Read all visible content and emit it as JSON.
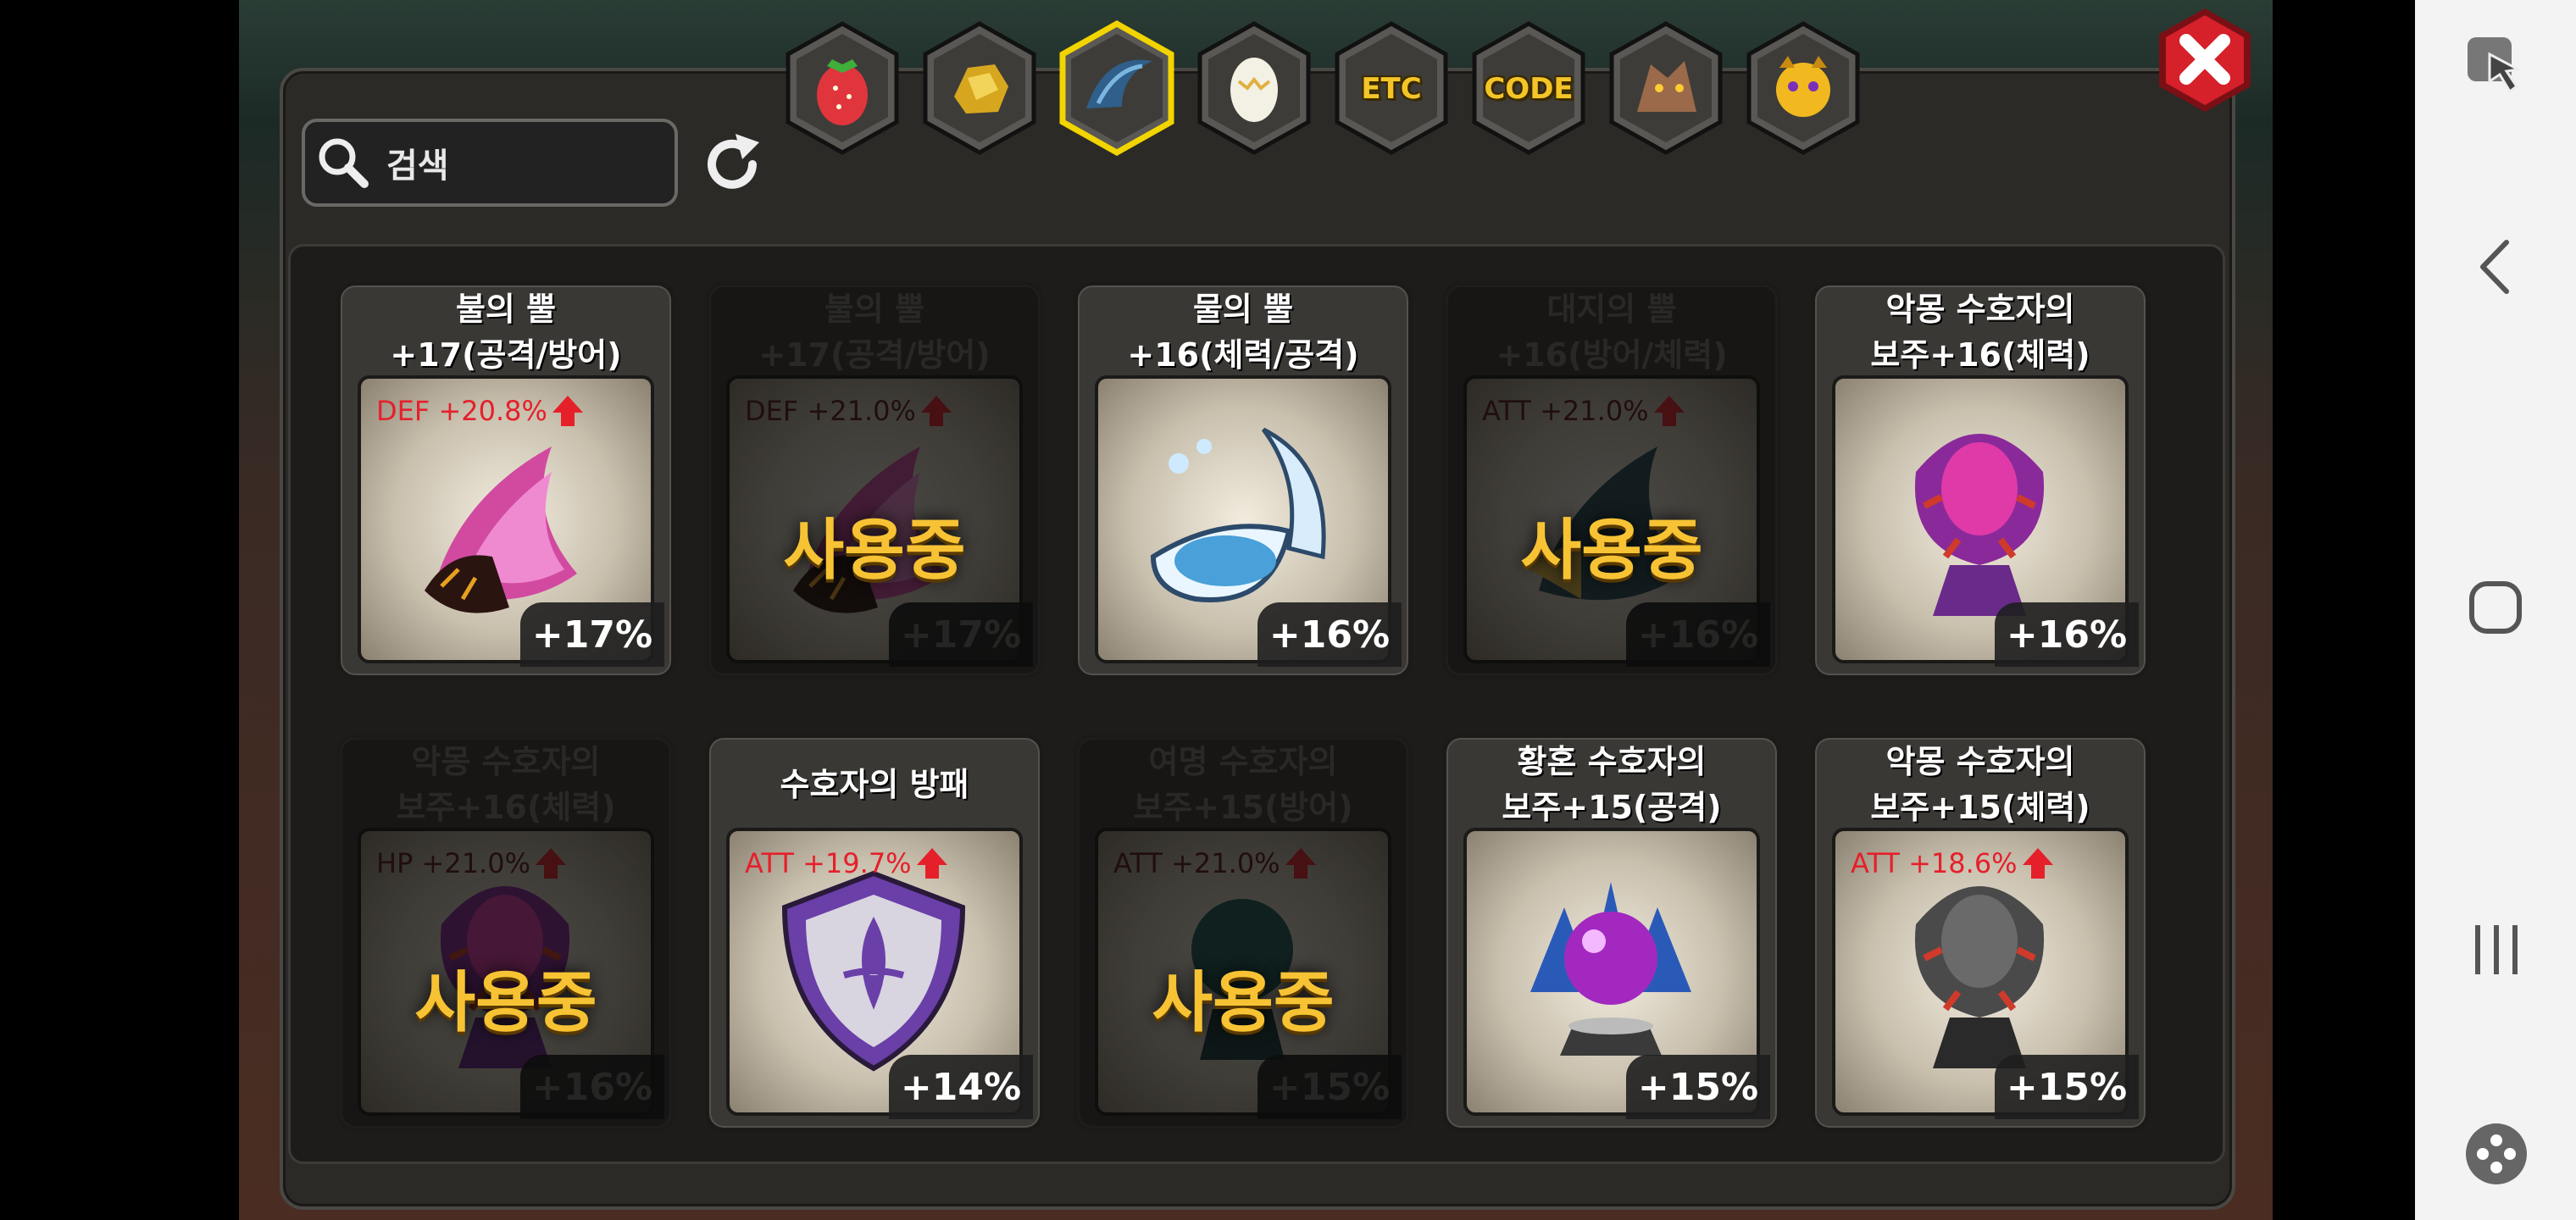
{
  "search": {
    "placeholder": "검색"
  },
  "tabs": [
    {
      "icon": "strawberry-icon",
      "label": ""
    },
    {
      "icon": "gold-ore-icon",
      "label": ""
    },
    {
      "icon": "dragon-horn-icon",
      "label": "",
      "selected": true
    },
    {
      "icon": "egg-icon",
      "label": ""
    },
    {
      "icon": "etc-icon",
      "label": "ETC"
    },
    {
      "icon": "code-icon",
      "label": "CODE"
    },
    {
      "icon": "dragon-head-icon",
      "label": ""
    },
    {
      "icon": "monster-face-icon",
      "label": ""
    }
  ],
  "in_use_label": "사용중",
  "items": [
    {
      "title1": "불의 뿔",
      "title2": "+17(공격/방어)",
      "stat": "DEF +20.8%",
      "percent": "+17%",
      "in_use": false,
      "art": "fire-horn-icon"
    },
    {
      "title1": "불의 뿔",
      "title2": "+17(공격/방어)",
      "stat": "DEF +21.0%",
      "percent": "+17%",
      "in_use": true,
      "art": "fire-horn-icon"
    },
    {
      "title1": "물의 뿔",
      "title2": "+16(체력/공격)",
      "stat": "",
      "percent": "+16%",
      "in_use": false,
      "art": "water-horn-icon"
    },
    {
      "title1": "대지의 뿔",
      "title2": "+16(방어/체력)",
      "stat": "ATT +21.0%",
      "percent": "+16%",
      "in_use": true,
      "art": "earth-horn-icon"
    },
    {
      "title1": "악몽 수호자의",
      "title2": "보주+16(체력)",
      "stat": "",
      "percent": "+16%",
      "in_use": false,
      "art": "nightmare-orb-icon"
    },
    {
      "title1": "악몽 수호자의",
      "title2": "보주+16(체력)",
      "stat": "HP +21.0%",
      "percent": "+16%",
      "in_use": true,
      "art": "nightmare-orb-icon"
    },
    {
      "title1": "수호자의 방패",
      "title2": "",
      "stat": "ATT +19.7%",
      "percent": "+14%",
      "in_use": false,
      "art": "guardian-shield-icon"
    },
    {
      "title1": "여명 수호자의",
      "title2": "보주+15(방어)",
      "stat": "ATT +21.0%",
      "percent": "+15%",
      "in_use": true,
      "art": "dawn-orb-icon"
    },
    {
      "title1": "황혼 수호자의",
      "title2": "보주+15(공격)",
      "stat": "",
      "percent": "+15%",
      "in_use": false,
      "art": "dusk-orb-icon"
    },
    {
      "title1": "악몽 수호자의",
      "title2": "보주+15(체력)",
      "stat": "ATT +18.6%",
      "percent": "+15%",
      "in_use": false,
      "art": "nightmare-orb-gray-icon"
    }
  ],
  "colors": {
    "accent_gold": "#f4c528",
    "stat_red": "#e5202b",
    "close_red": "#d6202a"
  }
}
